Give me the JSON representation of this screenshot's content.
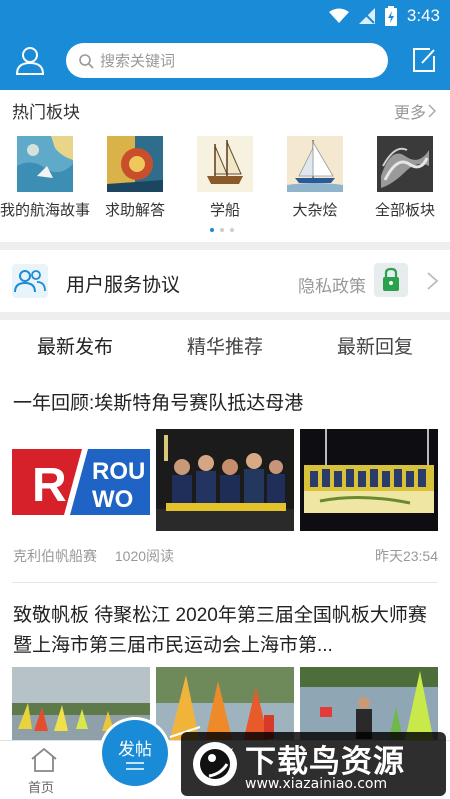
{
  "status_bar": {
    "time": "3:43"
  },
  "header": {
    "search_placeholder": "搜索关键词"
  },
  "hot_boards": {
    "title": "热门板块",
    "more_label": "更多",
    "items": [
      {
        "label": "我的航海故事"
      },
      {
        "label": "求助解答"
      },
      {
        "label": "学船"
      },
      {
        "label": "大杂烩"
      },
      {
        "label": "全部板块"
      }
    ],
    "page_count": 3,
    "active_page": 1
  },
  "agreement": {
    "label": "用户服务协议",
    "privacy_label": "隐私政策"
  },
  "tabs": [
    {
      "label": "最新发布",
      "active": true
    },
    {
      "label": "精华推荐",
      "active": false
    },
    {
      "label": "最新回复",
      "active": false
    }
  ],
  "posts": [
    {
      "title": "一年回顾:埃斯特角号赛队抵达母港",
      "source": "克利伯帆船赛",
      "reads": "1020阅读",
      "time": "昨天23:54",
      "thumb_text": "ROU\nWO"
    },
    {
      "title": "致敬帆板 待聚松江 2020年第三届全国帆板大师赛暨上海市第三届市民运动会上海市第..."
    }
  ],
  "bottom_nav": {
    "home_label": "首页",
    "post_button_label": "发帖"
  },
  "watermark": {
    "title": "下载鸟资源",
    "url": "www.xiazainiao.com"
  },
  "colors": {
    "brand_blue": "#1a8bd6",
    "lock_green": "#2aa14b"
  }
}
